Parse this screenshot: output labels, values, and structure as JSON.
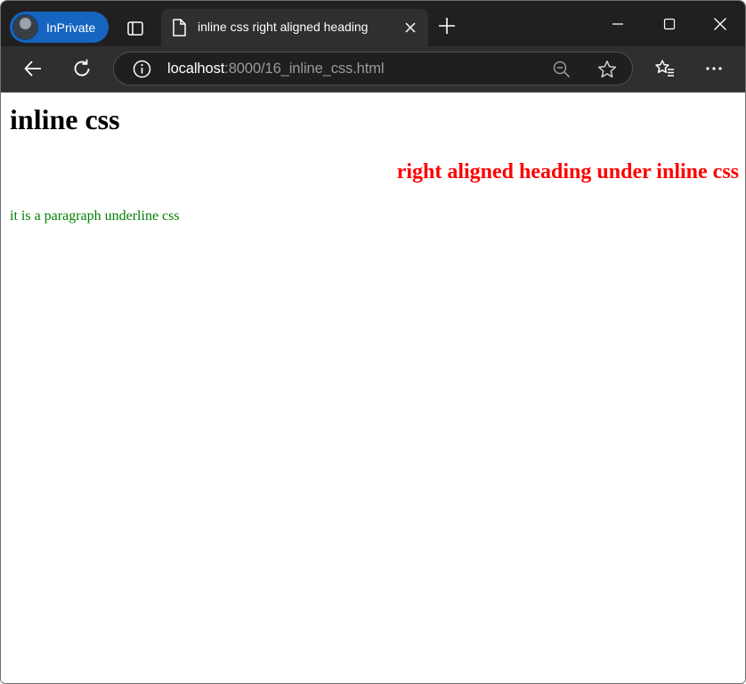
{
  "browser": {
    "profile_label": "InPrivate",
    "tab_title": "inline css right aligned heading",
    "url_host": "localhost",
    "url_path": ":8000/16_inline_css.html"
  },
  "page": {
    "heading": "inline css",
    "right_heading": "right aligned heading under inline css",
    "paragraph": "it is a paragraph underline css"
  },
  "colors": {
    "right_heading": "#ff0000",
    "paragraph": "#008000",
    "profile_pill": "#1665c0"
  }
}
